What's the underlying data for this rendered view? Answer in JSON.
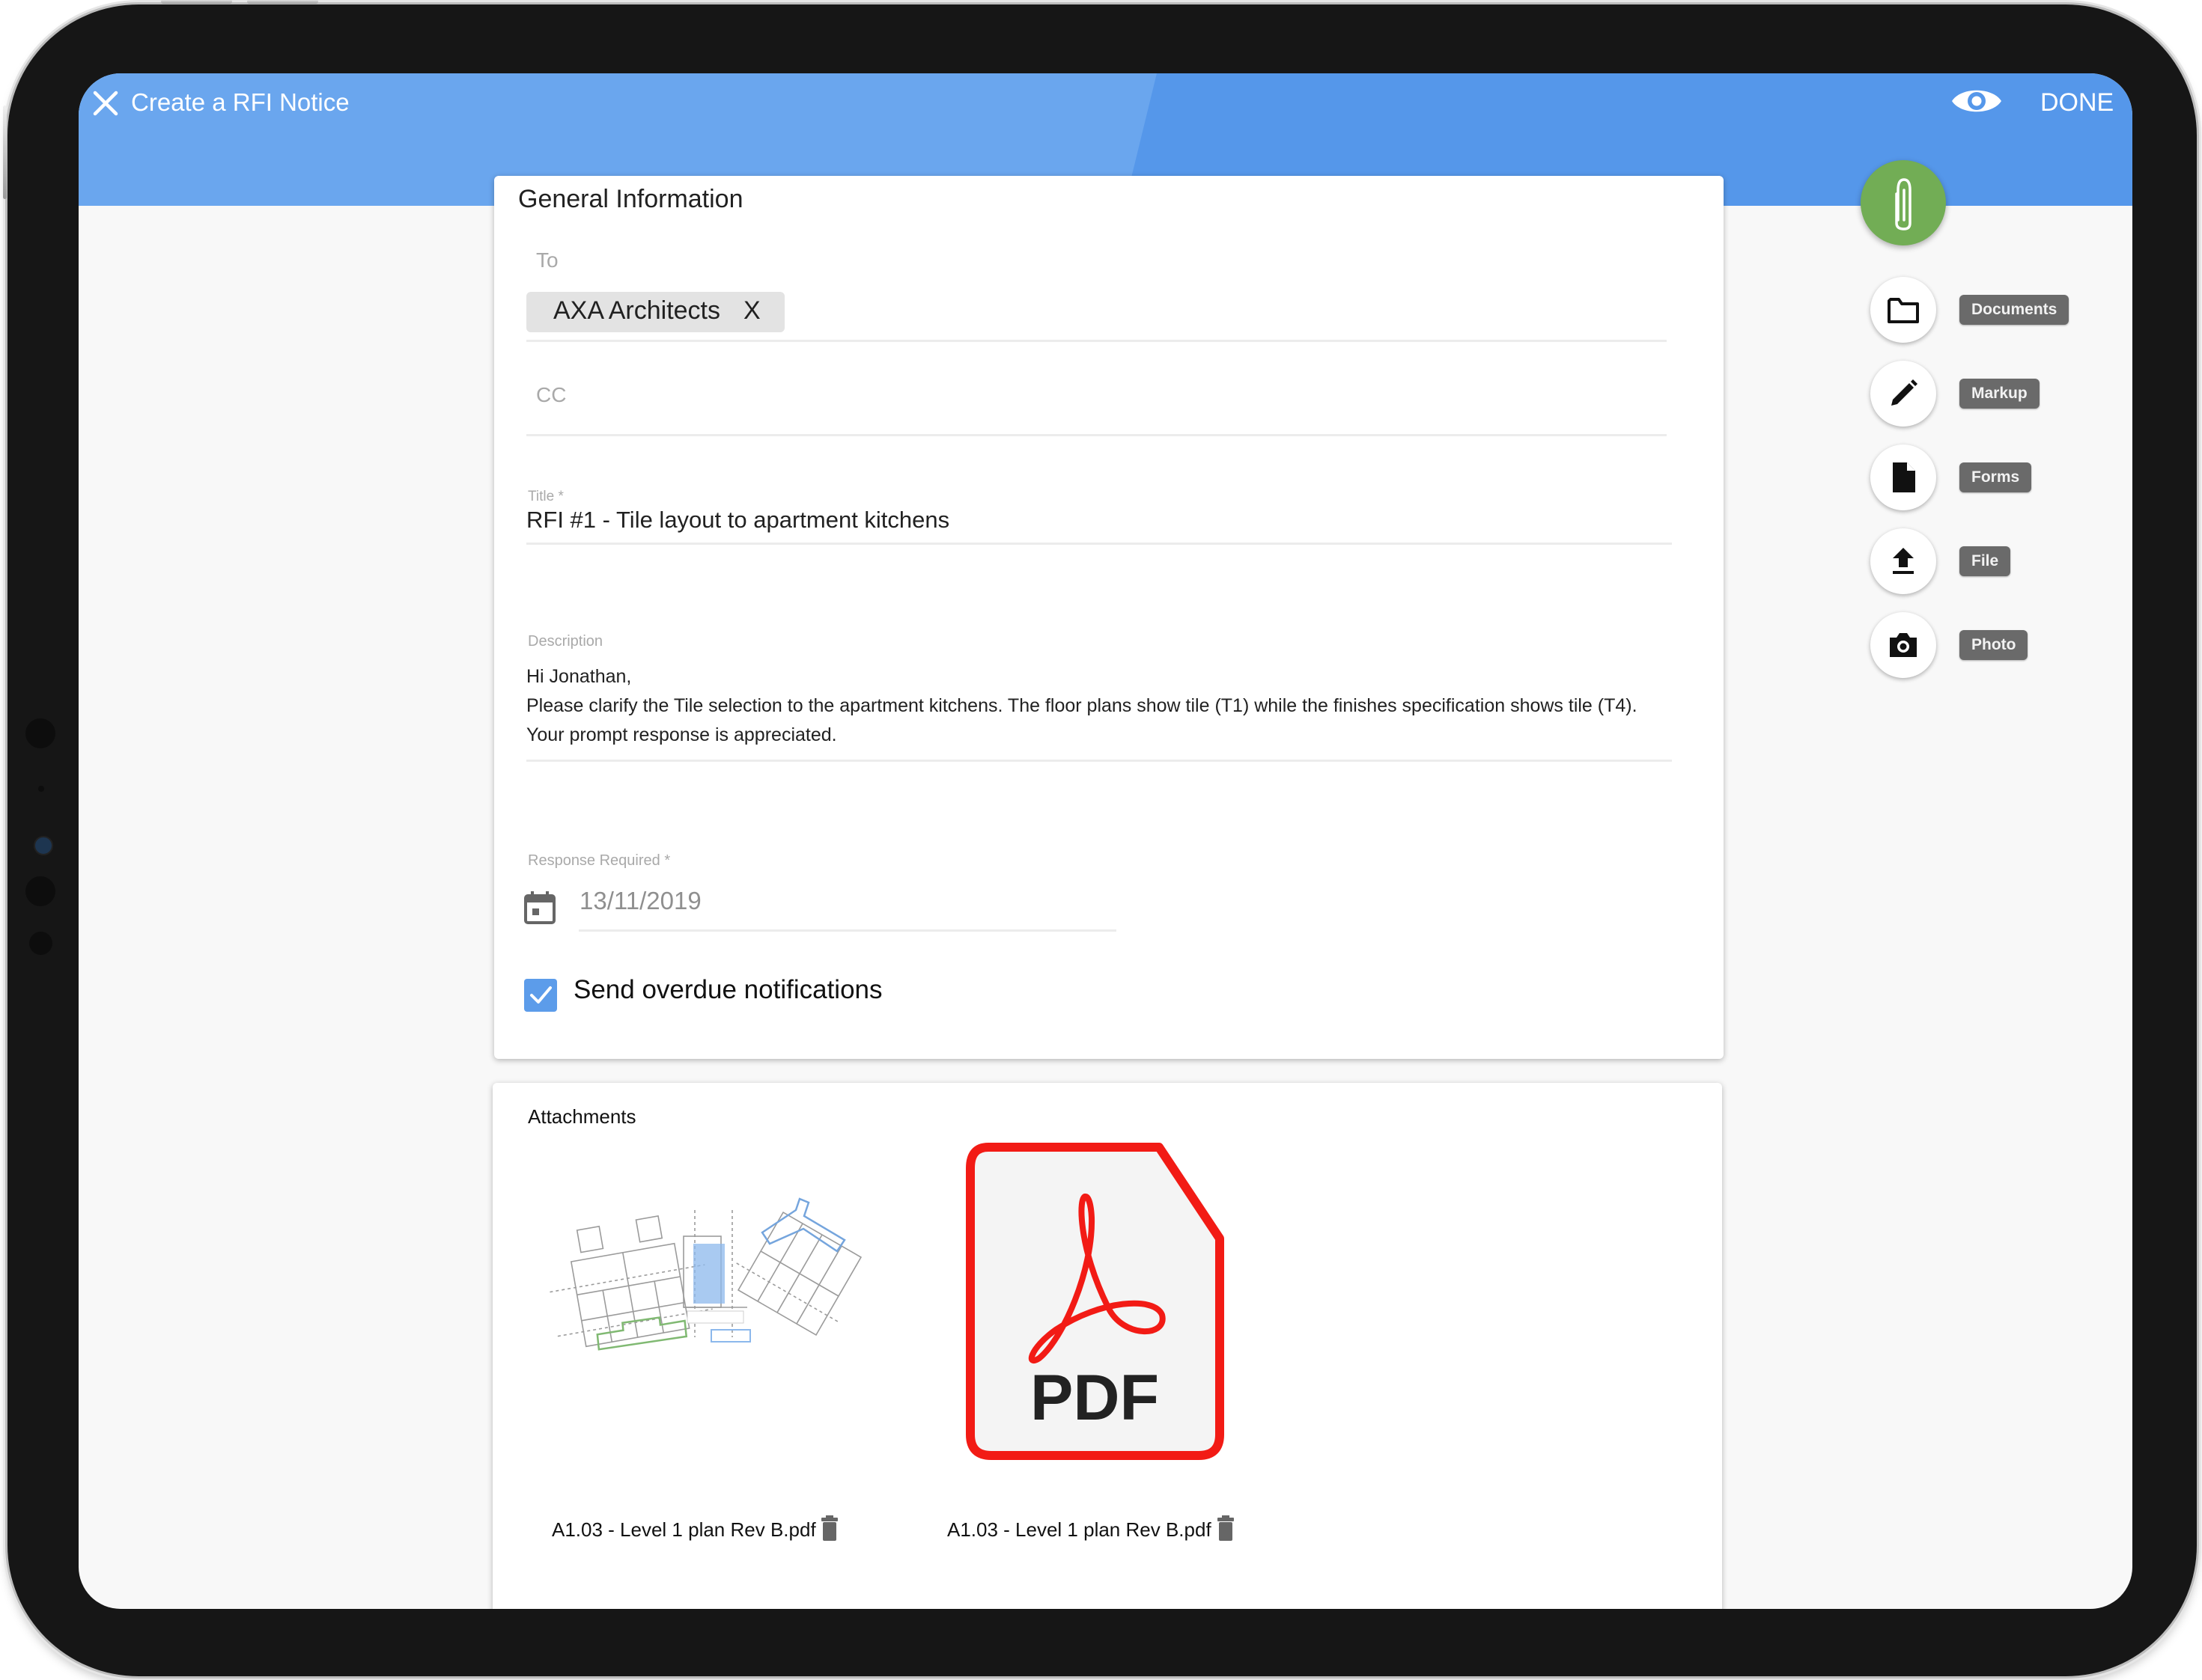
{
  "header": {
    "title": "Create a RFI Notice",
    "close_icon": "close-icon",
    "preview_icon": "eye-icon",
    "done_label": "DONE",
    "colors": {
      "primary": "#5597ea",
      "primary_light": "#6aa6ee"
    }
  },
  "general_information": {
    "section_title": "General Information",
    "to": {
      "label": "To",
      "recipients": [
        {
          "name": "AXA Architects",
          "remove_label": "X"
        }
      ]
    },
    "cc": {
      "label": "CC",
      "value": ""
    },
    "title": {
      "label": "Title *",
      "value": "RFI #1 - Tile layout to apartment kitchens"
    },
    "description": {
      "label": "Description",
      "lines": [
        "Hi Jonathan,",
        "Please clarify the Tile selection to the apartment kitchens. The floor plans show tile (T1) while the finishes specification shows tile (T4).",
        "Your prompt response is appreciated."
      ]
    },
    "response_required": {
      "label": "Response Required *",
      "value": "13/11/2019",
      "icon": "calendar-icon"
    },
    "overdue_notifications": {
      "label": "Send overdue notifications",
      "checked": true
    }
  },
  "attachments": {
    "section_title": "Attachments",
    "items": [
      {
        "file_name": "A1.03  - Level 1 plan Rev B.pdf",
        "preview": "floor-plan-thumbnail",
        "delete_icon": "trash-icon"
      },
      {
        "file_name": "A1.03  - Level 1 plan Rev B.pdf",
        "preview": "pdf-file-icon",
        "pdf_text": "PDF",
        "delete_icon": "trash-icon"
      }
    ]
  },
  "attach_menu": {
    "fab_icon": "paperclip-icon",
    "fab_color": "#72ad55",
    "actions": [
      {
        "label": "Documents",
        "icon": "folder-icon"
      },
      {
        "label": "Markup",
        "icon": "pencil-icon"
      },
      {
        "label": "Forms",
        "icon": "document-icon"
      },
      {
        "label": "File",
        "icon": "upload-icon"
      },
      {
        "label": "Photo",
        "icon": "camera-icon"
      }
    ]
  }
}
